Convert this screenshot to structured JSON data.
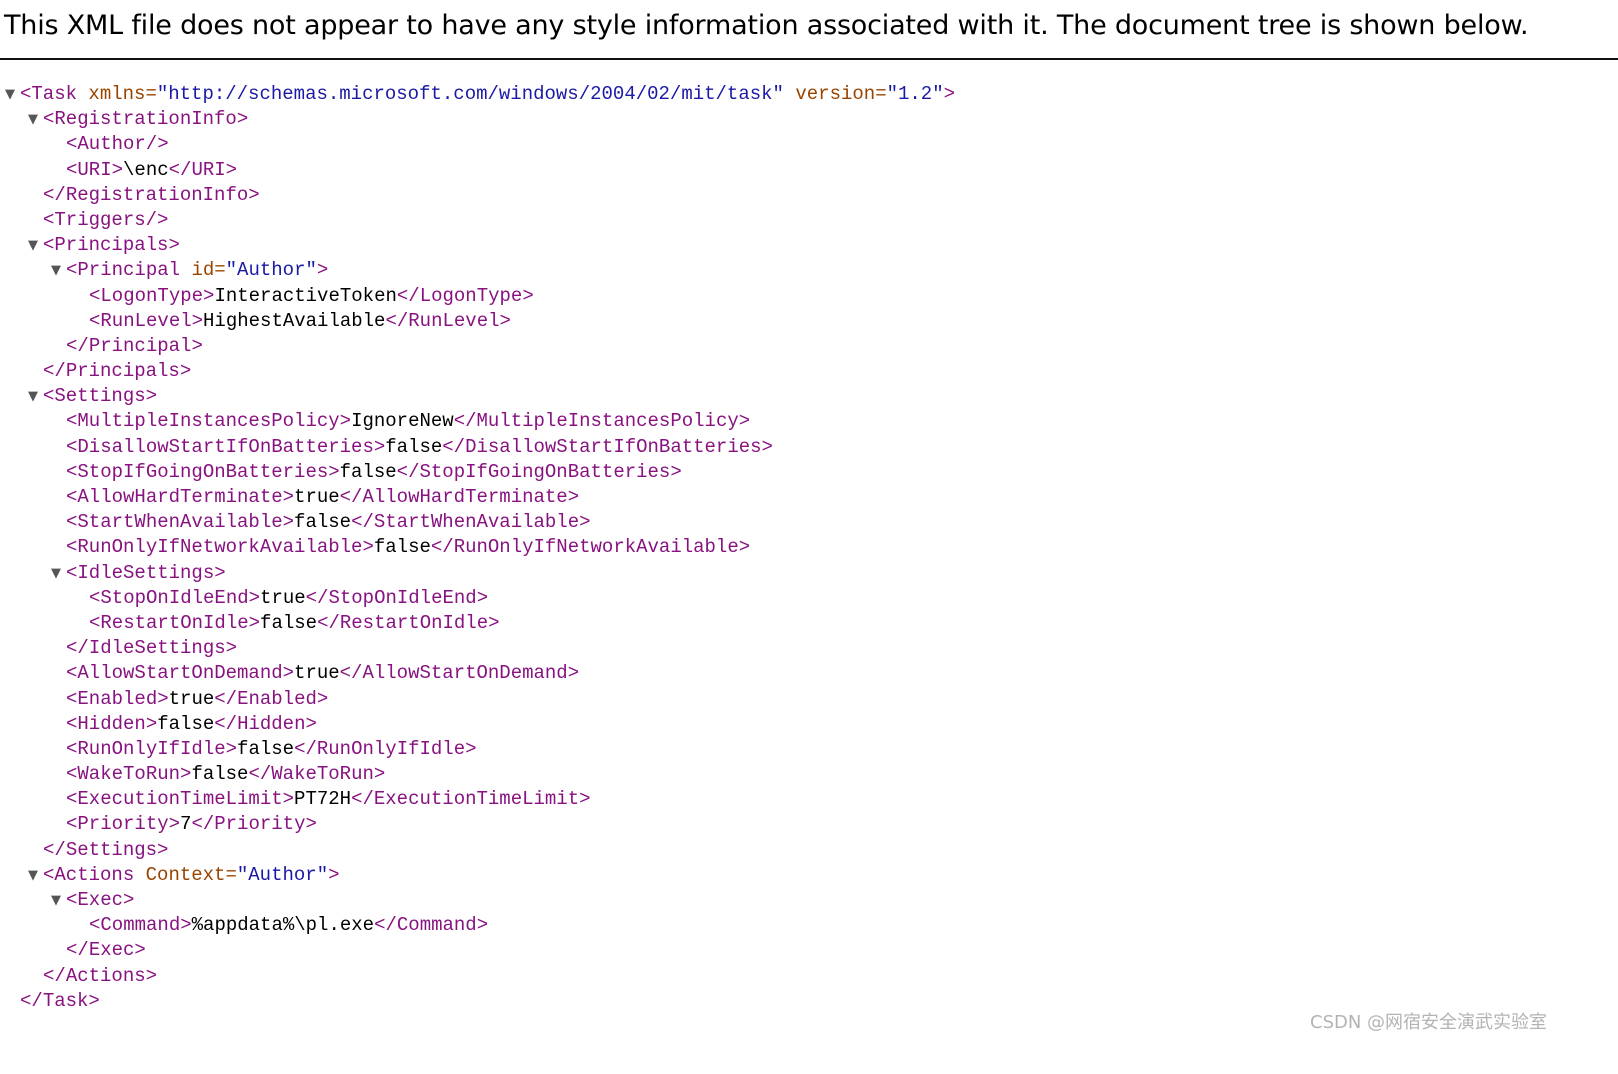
{
  "header": {
    "message": "This XML file does not appear to have any style information associated with it. The document tree is shown below."
  },
  "icons": {
    "toggle": "collapse-triangle-icon",
    "toggle_glyph": "▼"
  },
  "colors": {
    "tag": "#881280",
    "attr_name": "#994500",
    "attr_value": "#1a1aa6",
    "text": "#000000",
    "watermark": "#b3b3b3"
  },
  "tree": [
    {
      "depth": 0,
      "collapsible": true,
      "kind": "open",
      "tag": "Task",
      "attrs": [
        {
          "name": "xmlns",
          "value": "\"http://schemas.microsoft.com/windows/2004/02/mit/task\""
        },
        {
          "name": "version",
          "value": "\"1.2\""
        }
      ]
    },
    {
      "depth": 1,
      "collapsible": true,
      "kind": "open",
      "tag": "RegistrationInfo",
      "attrs": []
    },
    {
      "depth": 2,
      "collapsible": false,
      "kind": "empty",
      "tag": "Author",
      "attrs": []
    },
    {
      "depth": 2,
      "collapsible": false,
      "kind": "leaf",
      "tag": "URI",
      "text": "\\enc"
    },
    {
      "depth": 1,
      "collapsible": false,
      "kind": "close",
      "tag": "RegistrationInfo"
    },
    {
      "depth": 1,
      "collapsible": false,
      "kind": "empty",
      "tag": "Triggers",
      "attrs": []
    },
    {
      "depth": 1,
      "collapsible": true,
      "kind": "open",
      "tag": "Principals",
      "attrs": []
    },
    {
      "depth": 2,
      "collapsible": true,
      "kind": "open",
      "tag": "Principal",
      "attrs": [
        {
          "name": "id",
          "value": "\"Author\""
        }
      ]
    },
    {
      "depth": 3,
      "collapsible": false,
      "kind": "leaf",
      "tag": "LogonType",
      "text": "InteractiveToken"
    },
    {
      "depth": 3,
      "collapsible": false,
      "kind": "leaf",
      "tag": "RunLevel",
      "text": "HighestAvailable"
    },
    {
      "depth": 2,
      "collapsible": false,
      "kind": "close",
      "tag": "Principal"
    },
    {
      "depth": 1,
      "collapsible": false,
      "kind": "close",
      "tag": "Principals"
    },
    {
      "depth": 1,
      "collapsible": true,
      "kind": "open",
      "tag": "Settings",
      "attrs": []
    },
    {
      "depth": 2,
      "collapsible": false,
      "kind": "leaf",
      "tag": "MultipleInstancesPolicy",
      "text": "IgnoreNew"
    },
    {
      "depth": 2,
      "collapsible": false,
      "kind": "leaf",
      "tag": "DisallowStartIfOnBatteries",
      "text": "false"
    },
    {
      "depth": 2,
      "collapsible": false,
      "kind": "leaf",
      "tag": "StopIfGoingOnBatteries",
      "text": "false"
    },
    {
      "depth": 2,
      "collapsible": false,
      "kind": "leaf",
      "tag": "AllowHardTerminate",
      "text": "true"
    },
    {
      "depth": 2,
      "collapsible": false,
      "kind": "leaf",
      "tag": "StartWhenAvailable",
      "text": "false"
    },
    {
      "depth": 2,
      "collapsible": false,
      "kind": "leaf",
      "tag": "RunOnlyIfNetworkAvailable",
      "text": "false"
    },
    {
      "depth": 2,
      "collapsible": true,
      "kind": "open",
      "tag": "IdleSettings",
      "attrs": []
    },
    {
      "depth": 3,
      "collapsible": false,
      "kind": "leaf",
      "tag": "StopOnIdleEnd",
      "text": "true"
    },
    {
      "depth": 3,
      "collapsible": false,
      "kind": "leaf",
      "tag": "RestartOnIdle",
      "text": "false"
    },
    {
      "depth": 2,
      "collapsible": false,
      "kind": "close",
      "tag": "IdleSettings"
    },
    {
      "depth": 2,
      "collapsible": false,
      "kind": "leaf",
      "tag": "AllowStartOnDemand",
      "text": "true"
    },
    {
      "depth": 2,
      "collapsible": false,
      "kind": "leaf",
      "tag": "Enabled",
      "text": "true"
    },
    {
      "depth": 2,
      "collapsible": false,
      "kind": "leaf",
      "tag": "Hidden",
      "text": "false"
    },
    {
      "depth": 2,
      "collapsible": false,
      "kind": "leaf",
      "tag": "RunOnlyIfIdle",
      "text": "false"
    },
    {
      "depth": 2,
      "collapsible": false,
      "kind": "leaf",
      "tag": "WakeToRun",
      "text": "false"
    },
    {
      "depth": 2,
      "collapsible": false,
      "kind": "leaf",
      "tag": "ExecutionTimeLimit",
      "text": "PT72H"
    },
    {
      "depth": 2,
      "collapsible": false,
      "kind": "leaf",
      "tag": "Priority",
      "text": "7"
    },
    {
      "depth": 1,
      "collapsible": false,
      "kind": "close",
      "tag": "Settings"
    },
    {
      "depth": 1,
      "collapsible": true,
      "kind": "open",
      "tag": "Actions",
      "attrs": [
        {
          "name": "Context",
          "value": "\"Author\""
        }
      ]
    },
    {
      "depth": 2,
      "collapsible": true,
      "kind": "open",
      "tag": "Exec",
      "attrs": []
    },
    {
      "depth": 3,
      "collapsible": false,
      "kind": "leaf",
      "tag": "Command",
      "text": "%appdata%\\pl.exe"
    },
    {
      "depth": 2,
      "collapsible": false,
      "kind": "close",
      "tag": "Exec"
    },
    {
      "depth": 1,
      "collapsible": false,
      "kind": "close",
      "tag": "Actions"
    },
    {
      "depth": 0,
      "collapsible": false,
      "kind": "close",
      "tag": "Task"
    }
  ],
  "watermark": {
    "text": "CSDN @网宿安全演武实验室"
  }
}
